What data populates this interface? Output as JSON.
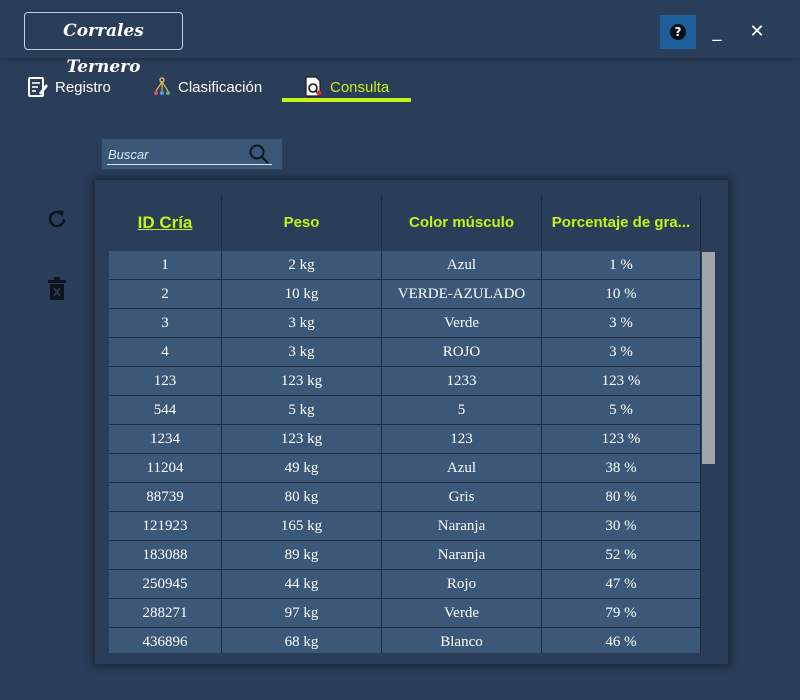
{
  "app": {
    "title": "Corrales Ternero"
  },
  "window_controls": {
    "help_label": "?",
    "minimize_label": "_",
    "close_label": "✕"
  },
  "tabs": [
    {
      "label": "Registro",
      "icon": "edit-document-icon",
      "active": false
    },
    {
      "label": "Clasificación",
      "icon": "hierarchy-icon",
      "active": false
    },
    {
      "label": "Consulta",
      "icon": "search-document-icon",
      "active": true
    }
  ],
  "colors": {
    "background": "#2a3e59",
    "accent": "#c6f21a",
    "cell": "#3b5878",
    "help_button": "#1d5f9b"
  },
  "search": {
    "placeholder": "Buscar",
    "value": ""
  },
  "actions": {
    "refresh_icon": "refresh-icon",
    "delete_icon": "trash-icon"
  },
  "table": {
    "headers": [
      "ID Cría",
      "Peso",
      "Color músculo",
      "Porcentaje de gra..."
    ],
    "rows": [
      [
        "1",
        "2 kg",
        "Azul",
        "1 %"
      ],
      [
        "2",
        "10 kg",
        "VERDE-AZULADO",
        "10 %"
      ],
      [
        "3",
        "3 kg",
        "Verde",
        "3 %"
      ],
      [
        "4",
        "3 kg",
        "ROJO",
        "3 %"
      ],
      [
        "123",
        "123 kg",
        "1233",
        "123 %"
      ],
      [
        "544",
        "5 kg",
        "5",
        "5 %"
      ],
      [
        "1234",
        "123 kg",
        "123",
        "123 %"
      ],
      [
        "11204",
        "49 kg",
        "Azul",
        "38 %"
      ],
      [
        "88739",
        "80 kg",
        "Gris",
        "80 %"
      ],
      [
        "121923",
        "165 kg",
        "Naranja",
        "30 %"
      ],
      [
        "183088",
        "89 kg",
        "Naranja",
        "52 %"
      ],
      [
        "250945",
        "44 kg",
        "Rojo",
        "47 %"
      ],
      [
        "288271",
        "97 kg",
        "Verde",
        "79 %"
      ],
      [
        "436896",
        "68 kg",
        "Blanco",
        "46 %"
      ]
    ]
  }
}
